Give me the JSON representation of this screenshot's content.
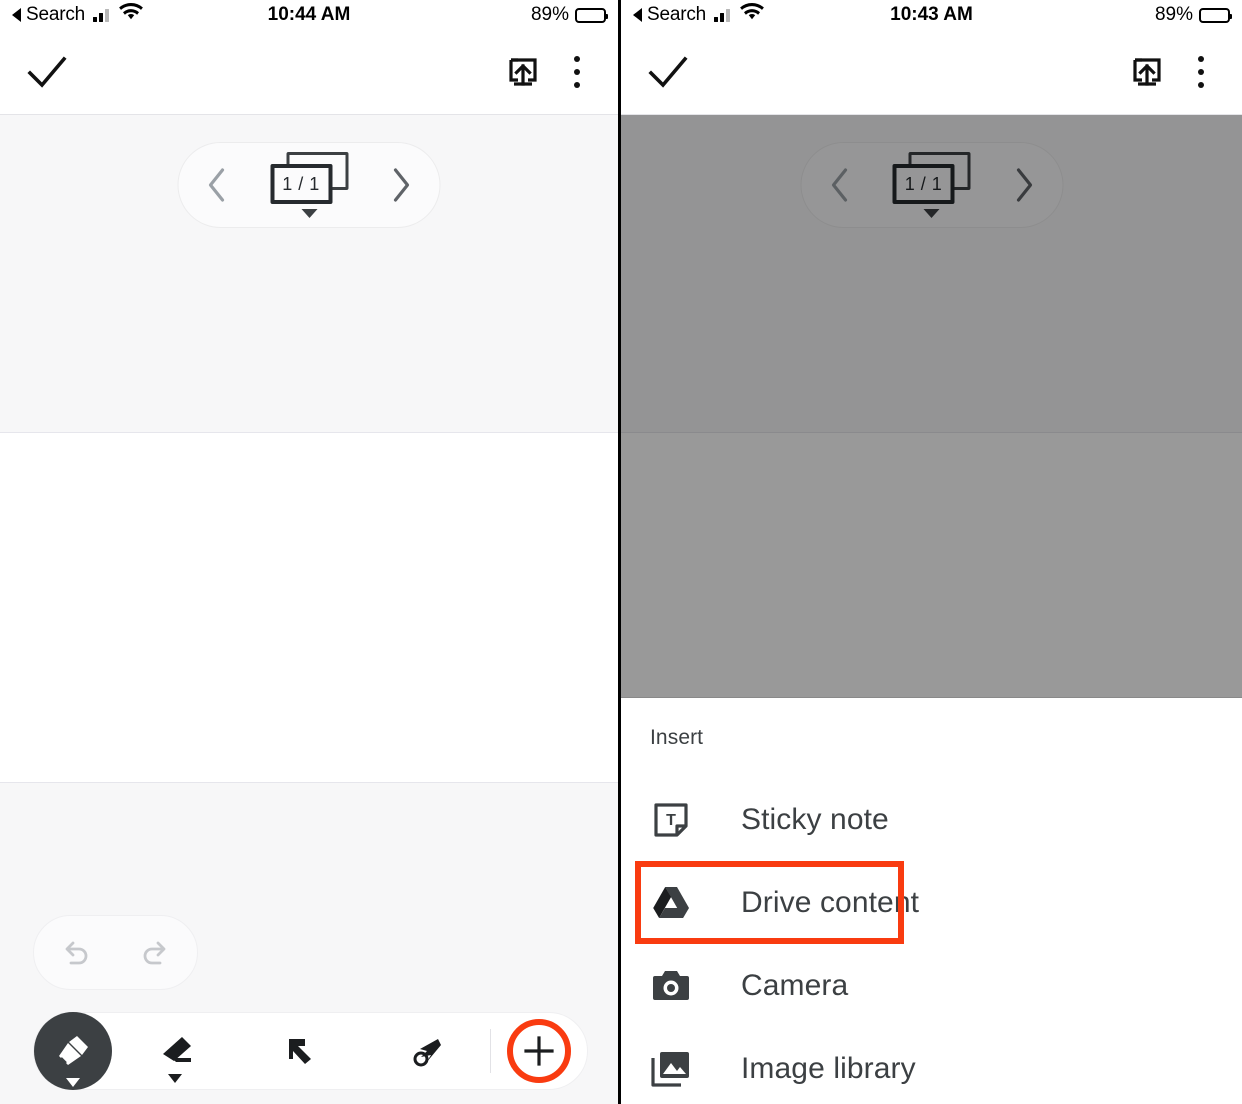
{
  "meta": {
    "app": "Google Slides / Jamboard mobile presentation editor",
    "accent_red": "#f93b10",
    "dark_icon": "#3c4043"
  },
  "panels": [
    {
      "id": "left",
      "status_bar": {
        "back_label": "Search",
        "time": "10:44 AM",
        "battery_percent": "89%",
        "signal_icon": "cellular-signal-icon",
        "wifi_icon": "wifi-icon",
        "battery_icon": "battery-icon"
      },
      "app_bar": {
        "done_icon": "checkmark-icon",
        "present_icon": "present-to-screen-icon",
        "more_icon": "more-options-kebab-icon"
      },
      "slide_nav": {
        "prev_icon": "chevron-left-icon",
        "next_icon": "chevron-right-icon",
        "counter": "1 / 1",
        "counter_icon": "slides-stack-icon",
        "expand_icon": "caret-down-icon"
      },
      "history": {
        "undo_icon": "undo-arrow-icon",
        "redo_icon": "redo-arrow-icon"
      },
      "toolbar": {
        "tools": [
          {
            "name": "pen-tool",
            "icon": "marker-pen-icon",
            "selected": true,
            "has_dropdown": true
          },
          {
            "name": "eraser-tool",
            "icon": "eraser-icon",
            "selected": false,
            "has_dropdown": true
          },
          {
            "name": "select-tool",
            "icon": "select-arrow-icon",
            "selected": false,
            "has_dropdown": false
          },
          {
            "name": "laser-pointer-tool",
            "icon": "laser-pointer-icon",
            "selected": false,
            "has_dropdown": false
          }
        ],
        "add_button": {
          "name": "insert-add-button",
          "icon": "plus-icon",
          "highlighted": true
        }
      }
    },
    {
      "id": "right",
      "dimmed": true,
      "status_bar": {
        "back_label": "Search",
        "time": "10:43 AM",
        "battery_percent": "89%",
        "signal_icon": "cellular-signal-icon",
        "wifi_icon": "wifi-icon",
        "battery_icon": "battery-icon"
      },
      "app_bar": {
        "done_icon": "checkmark-icon",
        "present_icon": "present-to-screen-icon",
        "more_icon": "more-options-kebab-icon"
      },
      "slide_nav": {
        "prev_icon": "chevron-left-icon",
        "next_icon": "chevron-right-icon",
        "counter": "1 / 1",
        "counter_icon": "slides-stack-icon",
        "expand_icon": "caret-down-icon"
      },
      "insert_sheet": {
        "title": "Insert",
        "items": [
          {
            "label": "Sticky note",
            "icon": "sticky-note-icon",
            "highlighted": false
          },
          {
            "label": "Drive content",
            "icon": "google-drive-icon",
            "highlighted": true
          },
          {
            "label": "Camera",
            "icon": "camera-icon",
            "highlighted": false
          },
          {
            "label": "Image library",
            "icon": "image-library-icon",
            "highlighted": false
          }
        ]
      }
    }
  ]
}
